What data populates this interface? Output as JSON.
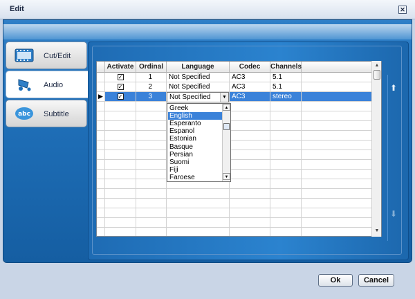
{
  "window": {
    "title": "Edit"
  },
  "tabs": [
    {
      "label": "Cut/Edit",
      "icon": "film-icon"
    },
    {
      "label": "Audio",
      "icon": "audio-note-icon"
    },
    {
      "label": "Subtitle",
      "icon": "abc-subtitle-icon"
    }
  ],
  "table": {
    "columns": [
      "Activate",
      "Ordinal",
      "Language",
      "Codec",
      "Channels"
    ],
    "rows": [
      {
        "activate": "✓",
        "ordinal": "1",
        "language": "Not Specified",
        "codec": "AC3",
        "channels": "5.1"
      },
      {
        "activate": "✓",
        "ordinal": "2",
        "language": "Not Specified",
        "codec": "AC3",
        "channels": "5.1"
      },
      {
        "activate": "✓",
        "ordinal": "3",
        "language": "Not Specified",
        "codec": "AC3",
        "channels": "stereo"
      }
    ],
    "row_marker": "▶"
  },
  "language_dropdown": {
    "current": "Not Specified",
    "options": [
      "Greek",
      "English",
      "Esperanto",
      "Espanol",
      "Estonian",
      "Basque",
      "Persian",
      "Suomi",
      "Fiji",
      "Faroese"
    ],
    "highlighted": "English"
  },
  "buttons": {
    "ok": "Ok",
    "cancel": "Cancel"
  },
  "colors": {
    "accent": "#1f6fb8",
    "selection": "#3b82d9"
  }
}
